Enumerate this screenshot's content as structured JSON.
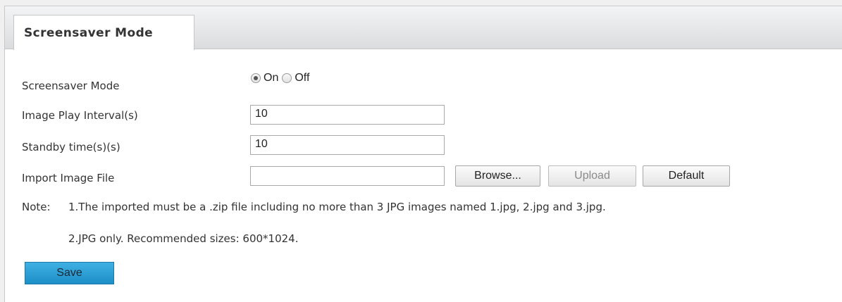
{
  "tab": {
    "title": "Screensaver Mode"
  },
  "form": {
    "screensaver_mode": {
      "label": "Screensaver Mode",
      "options": [
        "On",
        "Off"
      ],
      "selected": "On"
    },
    "image_play_interval": {
      "label": "Image Play Interval(s)",
      "value": "10"
    },
    "standby_time": {
      "label": "Standby time(s)(s)",
      "value": "10"
    },
    "import_image_file": {
      "label": "Import Image File",
      "value": "",
      "browse_label": "Browse...",
      "upload_label": "Upload",
      "upload_enabled": false,
      "default_label": "Default"
    }
  },
  "note": {
    "heading": "Note:",
    "lines": [
      "1.The imported must be a .zip file including no more than 3 JPG images named 1.jpg, 2.jpg and 3.jpg.",
      "2.JPG only. Recommended sizes: 600*1024."
    ]
  },
  "save_label": "Save",
  "colors": {
    "save_button": "#2a9fd6",
    "tab_bar": "#e4e6e8",
    "background": "#f0f0f0"
  }
}
